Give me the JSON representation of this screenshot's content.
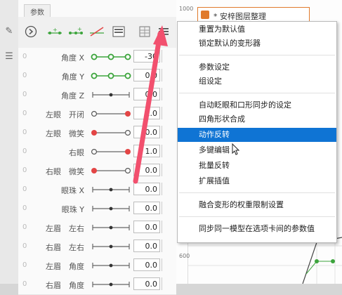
{
  "panel": {
    "tab": "参数",
    "params": [
      {
        "index": "0",
        "name": "角度 X",
        "value": "-30",
        "slider": "three-green"
      },
      {
        "index": "0",
        "name": "角度 Y",
        "value": "0.0",
        "slider": "three-green"
      },
      {
        "index": "0",
        "name": "角度 Z",
        "value": "0.0",
        "slider": "plain"
      },
      {
        "index": "0",
        "name": "左眼　开闭",
        "value": "1.0",
        "slider": "right-red"
      },
      {
        "index": "0",
        "name": "左眼　微笑",
        "value": "0.0",
        "slider": "left-red"
      },
      {
        "index": "0",
        "name": "右眼",
        "value": "1.0",
        "slider": "right-red"
      },
      {
        "index": "0",
        "name": "右眼　微笑",
        "value": "0.0",
        "slider": "left-red"
      },
      {
        "index": "0",
        "name": "眼珠 X",
        "value": "0.0",
        "slider": "plain"
      },
      {
        "index": "0",
        "name": "眼珠 Y",
        "value": "0.0",
        "slider": "plain"
      },
      {
        "index": "0",
        "name": "左眉　左右",
        "value": "0.0",
        "slider": "plain"
      },
      {
        "index": "0",
        "name": "右眉　左右",
        "value": "0.0",
        "slider": "plain"
      },
      {
        "index": "0",
        "name": "左眉　角度",
        "value": "0.0",
        "slider": "plain"
      },
      {
        "index": "0",
        "name": "右眉　角度",
        "value": "0.0",
        "slider": "plain"
      }
    ]
  },
  "canvas": {
    "ruler_top": "1000",
    "ruler_left": "600",
    "doc_tab": "* 安梓图层整理"
  },
  "menu": {
    "items": [
      {
        "label": "重置为默认值",
        "highlight": false
      },
      {
        "label": "锁定默认的变形器",
        "highlight": false
      },
      {
        "label": "参数设定",
        "highlight": false
      },
      {
        "label": "组设定",
        "highlight": false
      },
      {
        "label": "自动眨眼和口形同步的设定",
        "highlight": false
      },
      {
        "label": "四角形状合成",
        "highlight": false
      },
      {
        "label": "动作反转",
        "highlight": true
      },
      {
        "label": "多键编辑",
        "highlight": false
      },
      {
        "label": "批量反转",
        "highlight": false
      },
      {
        "label": "扩展插值",
        "highlight": false
      },
      {
        "label": "融合变形的权重限制设置",
        "highlight": false
      },
      {
        "label": "同步同一模型在选项卡间的参数值",
        "highlight": false
      }
    ]
  },
  "colors": {
    "accent": "#0f74d4",
    "arrow": "#f2506e",
    "key_green": "#3ca43c",
    "key_red": "#e34545",
    "doc_tab_orange": "#e07a2c"
  }
}
